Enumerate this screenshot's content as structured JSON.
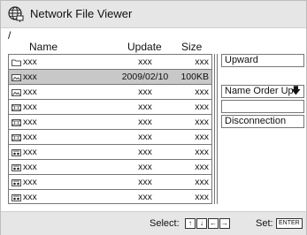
{
  "window": {
    "title": "Network File Viewer"
  },
  "path": "/",
  "columns": {
    "name": "Name",
    "update": "Update",
    "size": "Size"
  },
  "files": [
    {
      "icon": "folder-icon",
      "name": "xxx",
      "update": "xxx",
      "size": "xxx",
      "selected": false
    },
    {
      "icon": "image-icon",
      "name": "xxx",
      "update": "2009/02/10",
      "size": "100KB",
      "selected": true
    },
    {
      "icon": "image-icon",
      "name": "xxx",
      "update": "xxx",
      "size": "xxx",
      "selected": false
    },
    {
      "icon": "video-icon",
      "name": "xxx",
      "update": "xxx",
      "size": "xxx",
      "selected": false
    },
    {
      "icon": "video-icon",
      "name": "xxx",
      "update": "xxx",
      "size": "xxx",
      "selected": false
    },
    {
      "icon": "video-icon",
      "name": "xxx",
      "update": "xxx",
      "size": "xxx",
      "selected": false
    },
    {
      "icon": "audio-icon",
      "name": "xxx",
      "update": "xxx",
      "size": "xxx",
      "selected": false
    },
    {
      "icon": "audio-icon",
      "name": "xxx",
      "update": "xxx",
      "size": "xxx",
      "selected": false
    },
    {
      "icon": "audio-icon",
      "name": "xxx",
      "update": "xxx",
      "size": "xxx",
      "selected": false
    },
    {
      "icon": "audio-icon",
      "name": "xxx",
      "update": "xxx",
      "size": "xxx",
      "selected": false
    }
  ],
  "side_panel": {
    "upward": "Upward",
    "sort": "Name Order Up",
    "empty": "",
    "disconnect": "Disconnection"
  },
  "bottom": {
    "select_label": "Select:",
    "keys": [
      "↑",
      "↓",
      "←",
      "→"
    ],
    "set_label": "Set:",
    "enter_key": "ENTER"
  },
  "colors": {
    "bar": "#e6e6e6",
    "selected_row": "#c8c8c8",
    "border": "#777777"
  }
}
